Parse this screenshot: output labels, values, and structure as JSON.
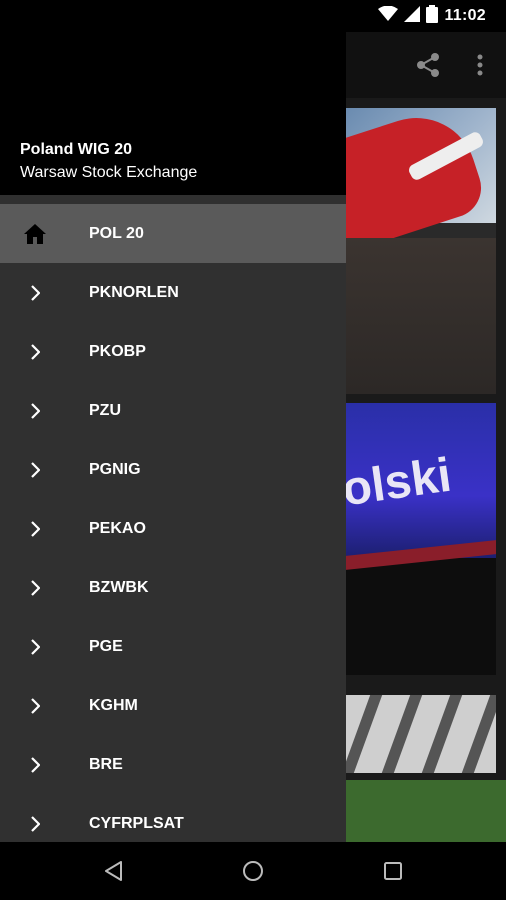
{
  "status_bar": {
    "time": "11:02"
  },
  "drawer": {
    "title": "Poland WIG 20",
    "subtitle": "Warsaw Stock Exchange",
    "items": [
      {
        "label": "POL 20",
        "icon": "home-icon",
        "active": true
      },
      {
        "label": "PKNORLEN",
        "icon": "chevron-right-icon"
      },
      {
        "label": "PKOBP",
        "icon": "chevron-right-icon"
      },
      {
        "label": "PZU",
        "icon": "chevron-right-icon"
      },
      {
        "label": "PGNIG",
        "icon": "chevron-right-icon"
      },
      {
        "label": "PEKAO",
        "icon": "chevron-right-icon"
      },
      {
        "label": "BZWBK",
        "icon": "chevron-right-icon"
      },
      {
        "label": "PGE",
        "icon": "chevron-right-icon"
      },
      {
        "label": "KGHM",
        "icon": "chevron-right-icon"
      },
      {
        "label": "BRE",
        "icon": "chevron-right-icon"
      },
      {
        "label": "CYFRPLSAT",
        "icon": "chevron-right-icon"
      }
    ]
  },
  "content": {
    "banner_text": "olski"
  },
  "colors": {
    "drawer_bg": "#303030",
    "active_item_bg": "#5a5a5a",
    "header_bg": "#000000"
  }
}
